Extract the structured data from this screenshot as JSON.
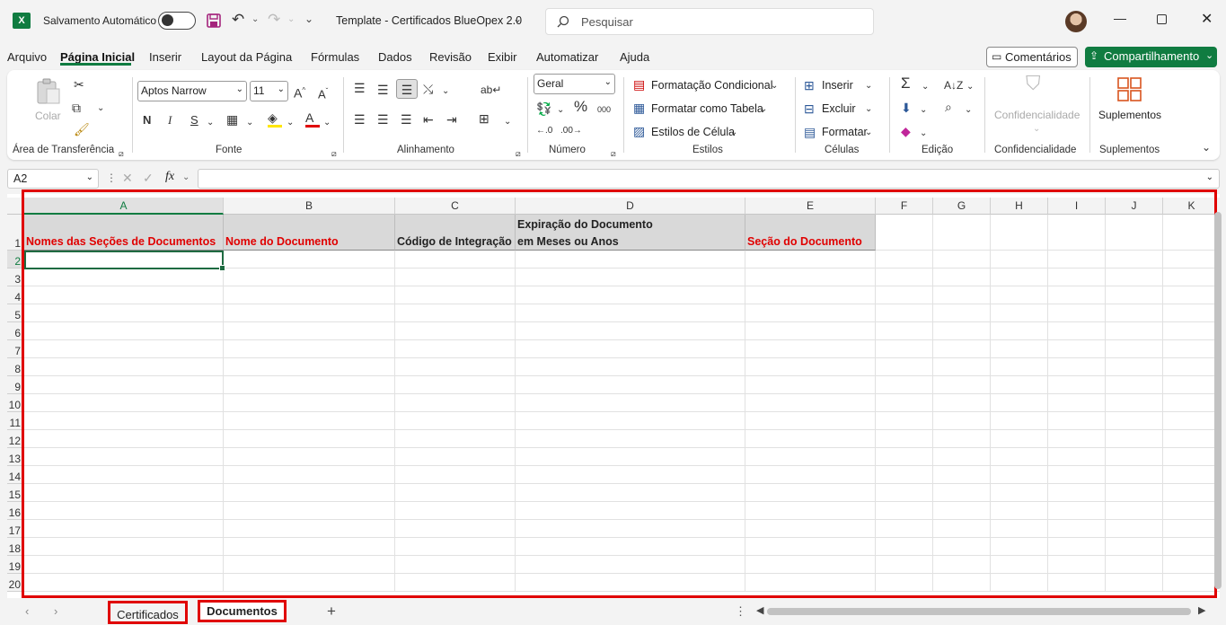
{
  "titlebar": {
    "autosave_label": "Salvamento Automático",
    "doc_title": "Template - Certificados BlueOpex 2.0",
    "search_placeholder": "Pesquisar"
  },
  "menu": {
    "items": [
      "Arquivo",
      "Página Inicial",
      "Inserir",
      "Layout da Página",
      "Fórmulas",
      "Dados",
      "Revisão",
      "Exibir",
      "Automatizar",
      "Ajuda"
    ],
    "comments_label": "Comentários",
    "share_label": "Compartilhamento"
  },
  "ribbon": {
    "clipboard": {
      "paste_label": "Colar",
      "group_label": "Área de Transferência"
    },
    "font": {
      "font_name": "Aptos Narrow",
      "font_size": "11",
      "bold": "N",
      "italic": "I",
      "underline": "S",
      "group_label": "Fonte"
    },
    "alignment": {
      "group_label": "Alinhamento"
    },
    "number": {
      "format": "Geral",
      "group_label": "Número"
    },
    "styles": {
      "conditional_label": "Formatação Condicional",
      "table_label": "Formatar como Tabela",
      "cell_styles_label": "Estilos de Célula",
      "group_label": "Estilos"
    },
    "cells": {
      "insert_label": "Inserir",
      "delete_label": "Excluir",
      "format_label": "Formatar",
      "group_label": "Células"
    },
    "editing": {
      "group_label": "Edição"
    },
    "sensitivity": {
      "button_label": "Confidencialidade",
      "group_label": "Confidencialidade"
    },
    "addins": {
      "button_label": "Suplementos",
      "group_label": "Suplementos"
    }
  },
  "formula_bar": {
    "name_box": "A2",
    "fx": "fx",
    "value": ""
  },
  "sheet": {
    "columns": [
      "A",
      "B",
      "C",
      "D",
      "E",
      "F",
      "G",
      "H",
      "I",
      "J",
      "K"
    ],
    "rows": [
      "1",
      "2",
      "3",
      "4",
      "5",
      "6",
      "7",
      "8",
      "9",
      "10",
      "11",
      "12",
      "13",
      "14",
      "15",
      "16",
      "17",
      "18",
      "19",
      "20"
    ],
    "headers": {
      "a1": "Nomes das Seções de Documentos",
      "b1": "Nome do Documento",
      "c1": "Código de Integração",
      "d1_line1": "Expiração do Documento",
      "d1_line2": "em Meses ou Anos",
      "e1": "Seção do Documento"
    },
    "header_colors": {
      "highlight_red": "#e00000",
      "header_fill": "#d9d9d9"
    }
  },
  "tabs": {
    "items": [
      "Certificados",
      "Documentos"
    ],
    "active": "Documentos"
  }
}
